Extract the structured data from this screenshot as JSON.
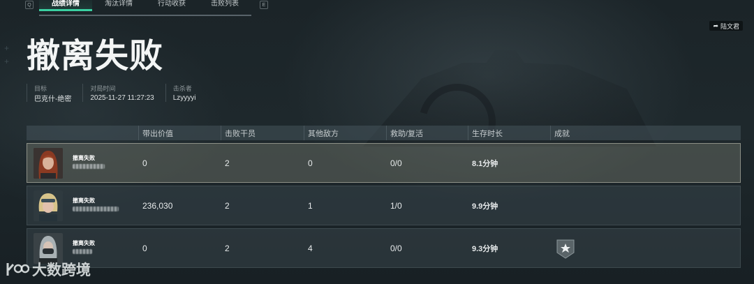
{
  "tabs": [
    "战绩详情",
    "淘汰详情",
    "行动收获",
    "击败列表"
  ],
  "key_hints": {
    "left": "Q",
    "right": "E"
  },
  "user_chip": {
    "icon": "share-icon",
    "name": "陆文君"
  },
  "title": "撤离失败",
  "meta": [
    {
      "label": "目标",
      "value": "巴克什-绝密"
    },
    {
      "label": "对局时间",
      "value": "2025-11-27 11:27:23"
    },
    {
      "label": "击杀者",
      "value": "Lzyyyyi"
    }
  ],
  "table": {
    "headers": [
      "带出价值",
      "击败干员",
      "其他敌方",
      "救助/复活",
      "生存时长",
      "成就"
    ],
    "rows": [
      {
        "status": "撤离失败",
        "value": "0",
        "kills": "2",
        "others": "0",
        "assist": "0/0",
        "time": "8.1分钟",
        "achievement": false,
        "highlight": true,
        "avatar": "red-hair-operator"
      },
      {
        "status": "撤离失败",
        "value": "236,030",
        "kills": "2",
        "others": "1",
        "assist": "1/0",
        "time": "9.9分钟",
        "achievement": false,
        "highlight": false,
        "avatar": "blonde-goggles-operator"
      },
      {
        "status": "撤离失败",
        "value": "0",
        "kills": "2",
        "others": "4",
        "assist": "0/0",
        "time": "9.3分钟",
        "achievement": true,
        "highlight": false,
        "avatar": "masked-operator"
      }
    ]
  },
  "watermark": "大数跨境",
  "colors": {
    "accent": "#3ad0a1",
    "highlight_row": "#74786c"
  }
}
